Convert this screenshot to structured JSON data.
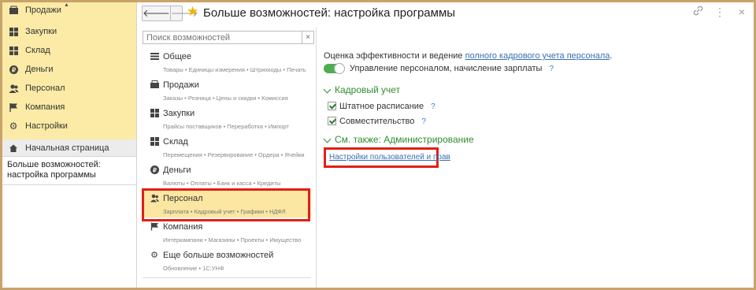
{
  "sidebar": {
    "items": [
      {
        "label": "Продажи",
        "icon": "sales-icon"
      },
      {
        "label": "Закупки",
        "icon": "purchases-icon"
      },
      {
        "label": "Склад",
        "icon": "warehouse-icon"
      },
      {
        "label": "Деньги",
        "icon": "money-icon"
      },
      {
        "label": "Персонал",
        "icon": "personnel-icon"
      },
      {
        "label": "Компания",
        "icon": "company-flag-icon"
      },
      {
        "label": "Настройки",
        "icon": "gear-icon"
      }
    ],
    "home_label": "Начальная страница",
    "open_window_label": "Больше возможностей: настройка программы"
  },
  "header": {
    "title": "Больше возможностей: настройка программы",
    "back_icon": "back-arrow-icon",
    "forward_icon": "forward-arrow-icon",
    "favorite_icon": "star-icon",
    "link_icon": "link-icon",
    "more_icon": "more-icon",
    "close_icon": "close-icon"
  },
  "search": {
    "placeholder": "Поиск возможностей",
    "clear": "×"
  },
  "categories": [
    {
      "label": "Общее",
      "sub": "Товары • Единицы измерения • Штрихкоды • Печать"
    },
    {
      "label": "Продажи",
      "sub": "Заказы • Розница • Цены и скидки • Комиссия"
    },
    {
      "label": "Закупки",
      "sub": "Прайсы поставщиков • Переработка • Импорт"
    },
    {
      "label": "Склад",
      "sub": "Перемещения • Резервирование • Ордера • Ячейки"
    },
    {
      "label": "Деньги",
      "sub": "Валюты • Оплаты • Банк и касса • Кредиты"
    },
    {
      "label": "Персонал",
      "sub": "Зарплата • Кадровый учет • Графики • НДФЛ"
    },
    {
      "label": "Компания",
      "sub": "Интеркампани • Магазины • Проекты • Имущество"
    },
    {
      "label": "Еще больше возможностей",
      "sub": "Обновление • 1С:УНФ"
    }
  ],
  "selected_category": "Персонал",
  "content": {
    "intro_text": "Оценка эффективности и ведение",
    "intro_link": "полного кадрового учета персонала",
    "intro_end": ".",
    "toggle_label": "Управление персоналом, начисление зарплаты",
    "toggle_on": true,
    "help": "?",
    "section_hr": "Кадровый учет",
    "checkbox_staff": "Штатное расписание",
    "checkbox_combination": "Совместительство",
    "section_admin": "См. также: Администрирование",
    "admin_link": "Настройки пользователей и прав"
  },
  "colors": {
    "accent_green": "#2f8d2f",
    "highlight_red": "#e21f17",
    "link_blue": "#3a6fb0",
    "selection_yellow": "#fbe6a2"
  }
}
